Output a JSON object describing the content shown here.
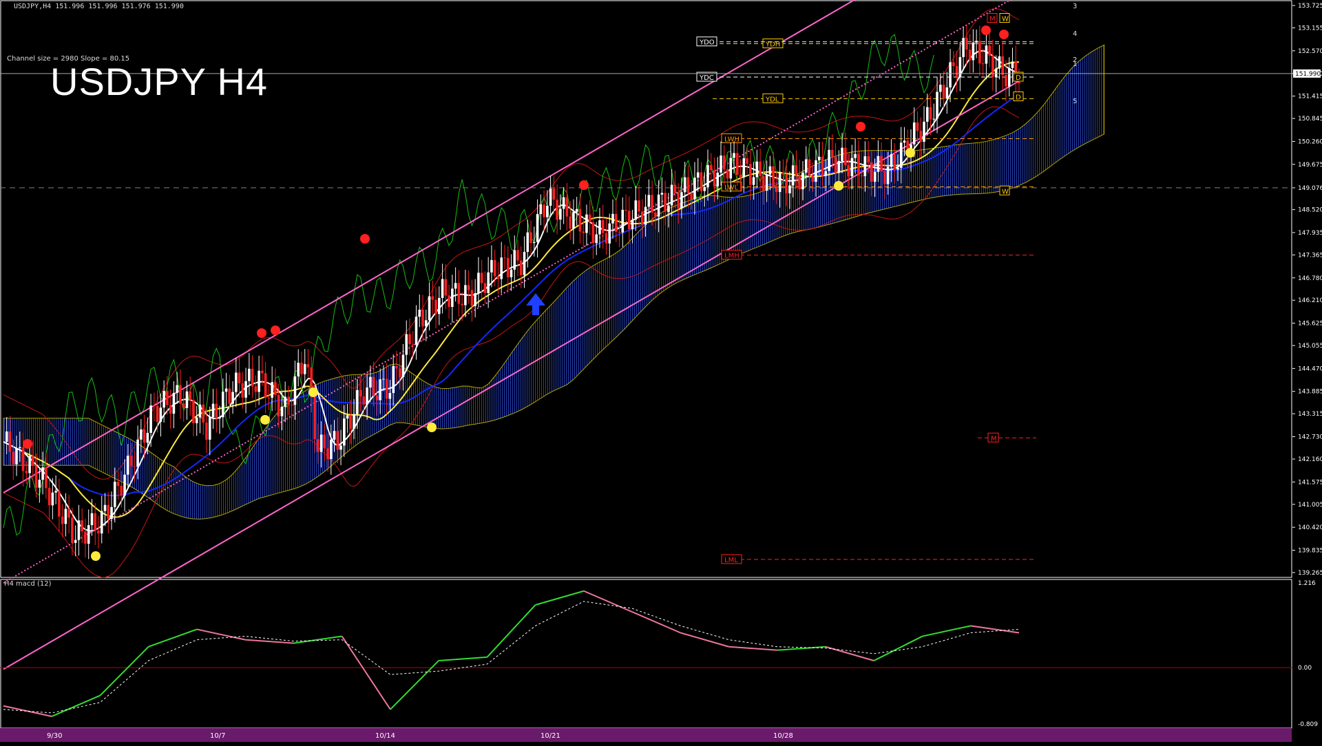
{
  "header": {
    "ohlc": "USDJPY,H4  151.996 151.996 151.976 151.990",
    "channel_info": "Channel size = 2980 Slope = 80.15",
    "title": "USDJPY H4"
  },
  "macd_panel": {
    "label": "H4  macd (12)"
  },
  "colors": {
    "bg": "#000000",
    "axis": "#ffffff",
    "grid_dash": "#808080",
    "bull": "#ffffff",
    "bear": "#ff2020",
    "ma_white": "#ffffff",
    "ma_yellow": "#ffeb3b",
    "ma_blue": "#1428ff",
    "channel": "#ff66cc",
    "chikou": "#12c012",
    "bands": "#c81414",
    "macd_up": "#33dd33",
    "macd_down": "#ee7799",
    "zero": "#c00000"
  },
  "chart_data": [
    {
      "type": "candlestick",
      "title": "USDJPY H4",
      "ylim": [
        139.265,
        153.725
      ],
      "y_ticks": [
        "153.725",
        "153.155",
        "152.570",
        "151.990",
        "151.415",
        "150.845",
        "150.260",
        "149.675",
        "149.076",
        "148.520",
        "147.935",
        "147.365",
        "146.780",
        "146.210",
        "145.625",
        "145.055",
        "144.470",
        "143.885",
        "143.315",
        "142.730",
        "142.160",
        "141.575",
        "141.005",
        "140.420",
        "139.835",
        "139.265"
      ],
      "current_price": "151.990",
      "x_labels": [
        "9/30",
        "10/7",
        "10/14",
        "10/21",
        "10/28"
      ],
      "close_path": [
        [
          0,
          142.6
        ],
        [
          12,
          141.6
        ],
        [
          22,
          140.2
        ],
        [
          30,
          140.6
        ],
        [
          38,
          141.9
        ],
        [
          46,
          143.4
        ],
        [
          54,
          143.8
        ],
        [
          62,
          143.0
        ],
        [
          70,
          144.0
        ],
        [
          78,
          144.2
        ],
        [
          86,
          143.4
        ],
        [
          92,
          144.8
        ],
        [
          96,
          142.4
        ],
        [
          102,
          142.6
        ],
        [
          110,
          143.9
        ],
        [
          118,
          144.0
        ],
        [
          126,
          145.6
        ],
        [
          134,
          146.4
        ],
        [
          142,
          146.3
        ],
        [
          150,
          147.0
        ],
        [
          158,
          147.2
        ],
        [
          166,
          148.8
        ],
        [
          174,
          148.3
        ],
        [
          182,
          147.9
        ],
        [
          190,
          148.3
        ],
        [
          198,
          148.6
        ],
        [
          206,
          148.9
        ],
        [
          214,
          149.3
        ],
        [
          222,
          149.7
        ],
        [
          230,
          149.4
        ],
        [
          238,
          149.2
        ],
        [
          246,
          149.5
        ],
        [
          254,
          149.8
        ],
        [
          262,
          149.6
        ],
        [
          270,
          149.5
        ],
        [
          276,
          150.2
        ],
        [
          282,
          150.8
        ],
        [
          288,
          151.8
        ],
        [
          294,
          152.7
        ],
        [
          300,
          152.4
        ],
        [
          305,
          152.0
        ],
        [
          310,
          151.99
        ]
      ],
      "levels": [
        {
          "label": "YDH",
          "y": 152.75,
          "color": "#ffcc00"
        },
        {
          "label": "YDO",
          "y": 152.8,
          "color": "#ffffff"
        },
        {
          "label": "YDC",
          "y": 151.9,
          "color": "#ffffff"
        },
        {
          "label": "YDL",
          "y": 151.35,
          "color": "#ffcc00"
        },
        {
          "label": "LWH",
          "y": 150.33,
          "color": "#ff9900"
        },
        {
          "label": "LWL",
          "y": 149.1,
          "color": "#ff9900"
        },
        {
          "label": "LMH",
          "y": 147.36,
          "color": "#ff2020"
        },
        {
          "label": "LML",
          "y": 139.6,
          "color": "#ff2020"
        },
        {
          "label": "M",
          "y": 142.7,
          "color": "#ff2020"
        }
      ],
      "markers": [
        {
          "label": "M",
          "y": 153.4
        },
        {
          "label": "W",
          "y": 153.4
        },
        {
          "label": "D",
          "y": 151.9
        },
        {
          "label": "D",
          "y": 151.4
        },
        {
          "label": "W",
          "y": 149.0
        }
      ],
      "fib_labels": [
        "3",
        "4",
        "2",
        "1",
        "5"
      ]
    },
    {
      "type": "line",
      "title": "H4  macd (12)",
      "ylim": [
        -0.809,
        1.216
      ],
      "y_ticks": [
        "1.216",
        "0.00",
        "-0.809"
      ],
      "series": [
        {
          "values": [
            -0.55,
            -0.7,
            -0.4,
            0.3,
            0.55,
            0.4,
            0.35,
            0.45,
            -0.6,
            0.1,
            0.15,
            0.9,
            1.1,
            0.8,
            0.5,
            0.3,
            0.25,
            0.3,
            0.1,
            0.45,
            0.6,
            0.5
          ]
        },
        {
          "values": [
            -0.6,
            -0.65,
            -0.5,
            0.1,
            0.4,
            0.45,
            0.38,
            0.4,
            -0.1,
            -0.05,
            0.05,
            0.6,
            0.95,
            0.85,
            0.6,
            0.4,
            0.3,
            0.28,
            0.2,
            0.3,
            0.5,
            0.55
          ]
        }
      ]
    }
  ]
}
